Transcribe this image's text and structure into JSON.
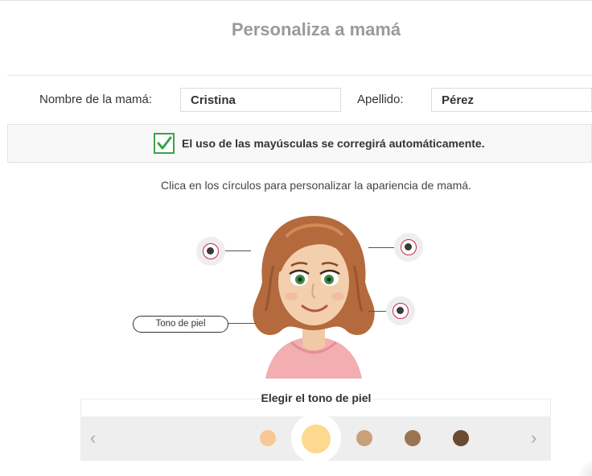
{
  "page": {
    "title": "Personaliza a mamá"
  },
  "form": {
    "first_name_label": "Nombre de la mamá:",
    "first_name_value": "Cristina",
    "last_name_label": "Apellido:",
    "last_name_value": "Pérez"
  },
  "notice": {
    "checked": true,
    "text": "El uso de las mayúsculas se corregirá automáticamente."
  },
  "instructions": "Clica en los círculos para personalizar la apariencia de mamá.",
  "hotspots": {
    "active_label": "Tono de piel"
  },
  "skin_picker": {
    "title": "Elegir el tono de piel",
    "prev_icon": "‹",
    "next_icon": "›",
    "selected_index": 1,
    "swatches": [
      "#f7c896",
      "#fdd98f",
      "#c9a07c",
      "#9a7552",
      "#6b4a30"
    ]
  },
  "colors": {
    "accent_check": "#3aa34a",
    "hotspot_ring": "#c4294e",
    "title_gray": "#9a9a9a"
  }
}
